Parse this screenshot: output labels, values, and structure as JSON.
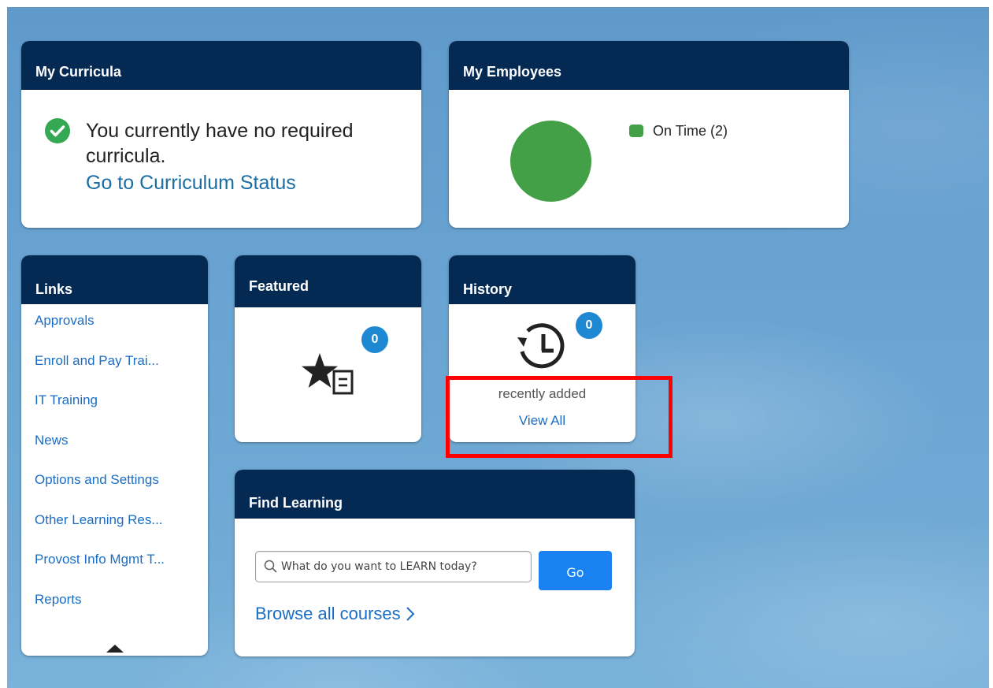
{
  "curricula": {
    "title": "My Curricula",
    "message": "You currently have no required curricula.",
    "link": "Go to Curriculum Status"
  },
  "employees": {
    "title": "My Employees",
    "legend_label": "On Time (2)",
    "on_time_count": 2,
    "color": "#43a047"
  },
  "links": {
    "title": "Links",
    "items": [
      "Approvals",
      "Enroll and Pay Trai...",
      "IT Training",
      "News",
      "Options and Settings",
      "Other Learning Res...",
      "Provost Info Mgmt T...",
      "Reports"
    ],
    "scroll_icon": "triangle-up-icon"
  },
  "featured": {
    "title": "Featured",
    "count": "0",
    "icon": "star-document-icon"
  },
  "history": {
    "title": "History",
    "count": "0",
    "icon": "history-clock-icon",
    "subtitle": "recently added",
    "link": "View All"
  },
  "find_learning": {
    "title": "Find Learning",
    "search_placeholder": "What do you want to LEARN today?",
    "go_label": "Go",
    "browse_label": "Browse all courses",
    "browse_icon": "chevron-right-icon"
  },
  "colors": {
    "header_bg": "#042a54",
    "link": "#1a6dc4",
    "badge": "#1e88d2",
    "go_button": "#1a82f0",
    "check": "#34a853",
    "highlight": "#ff0000"
  }
}
